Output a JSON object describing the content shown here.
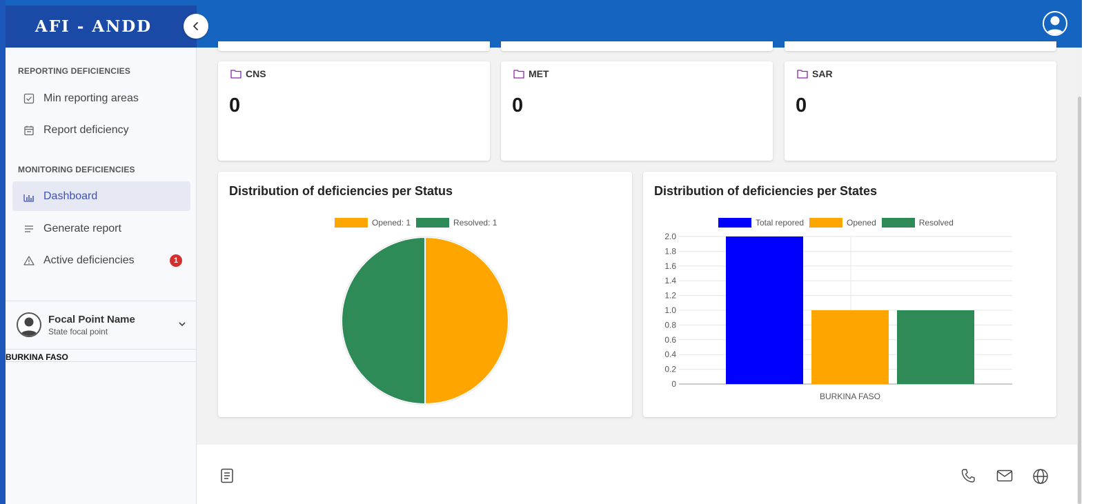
{
  "app": {
    "title": "AFI - ANDD"
  },
  "sidebar": {
    "section_reporting": "REPORTING DEFICIENCIES",
    "section_monitoring": "MONITORING DEFICIENCIES",
    "items": [
      {
        "label": "Min reporting areas",
        "icon": "checkbox-icon"
      },
      {
        "label": "Report deficiency",
        "icon": "calendar-icon"
      },
      {
        "label": "Dashboard",
        "icon": "bar-chart-icon",
        "active": true
      },
      {
        "label": "Generate report",
        "icon": "list-icon"
      },
      {
        "label": "Active deficiencies",
        "icon": "warning-icon",
        "badge": "1"
      }
    ],
    "user": {
      "name": "Focal Point Name",
      "role": "State focal point"
    },
    "state": "BURKINA FASO"
  },
  "stats": [
    {
      "label": "CNS",
      "value": "0",
      "icon": "folder-icon"
    },
    {
      "label": "MET",
      "value": "0",
      "icon": "folder-icon"
    },
    {
      "label": "SAR",
      "value": "0",
      "icon": "folder-icon"
    }
  ],
  "colors": {
    "header": "#1565c0",
    "brand": "#1b4aa6",
    "orange": "#ffa500",
    "green": "#2e8b57",
    "blue": "#0000ff",
    "folder": "#8e24aa",
    "badge": "#d32f2f"
  },
  "chart_data": [
    {
      "type": "pie",
      "title": "Distribution of deficiencies per Status",
      "slices": [
        {
          "label": "Opened: 1",
          "value": 1,
          "color": "#ffa500"
        },
        {
          "label": "Resolved: 1",
          "value": 1,
          "color": "#2e8b57"
        }
      ],
      "legend": "top"
    },
    {
      "type": "bar",
      "title": "Distribution of deficiencies per States",
      "categories": [
        "BURKINA FASO"
      ],
      "series": [
        {
          "name": "Total repored",
          "values": [
            2
          ],
          "color": "#0000ff"
        },
        {
          "name": "Opened",
          "values": [
            1
          ],
          "color": "#ffa500"
        },
        {
          "name": "Resolved",
          "values": [
            1
          ],
          "color": "#2e8b57"
        }
      ],
      "ylim": [
        0,
        2
      ],
      "yticks": [
        "0",
        "0.2",
        "0.4",
        "0.6",
        "0.8",
        "1.0",
        "1.2",
        "1.4",
        "1.6",
        "1.8",
        "2.0"
      ],
      "grid": true,
      "legend": "top"
    }
  ],
  "footer": {
    "icons": [
      "document-icon",
      "phone-icon",
      "mail-icon",
      "globe-icon"
    ]
  }
}
